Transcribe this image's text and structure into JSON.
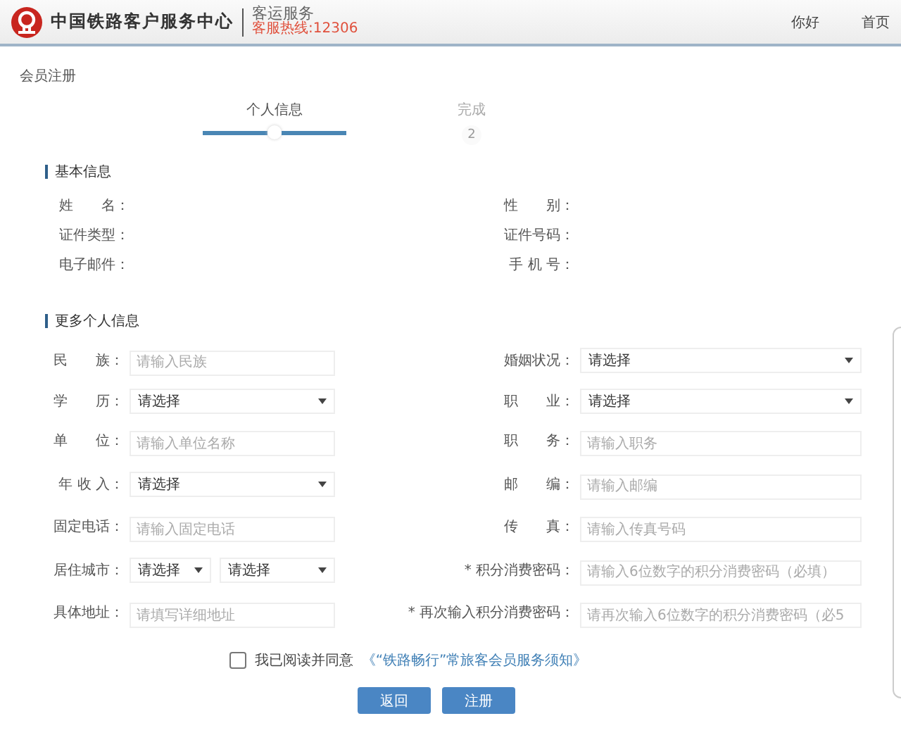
{
  "header": {
    "brand": "中国铁路客户服务中心",
    "service": "客运服务",
    "hotline": "客服热线:12306",
    "greeting": "你好",
    "home_link": "首页"
  },
  "breadcrumb": "会员注册",
  "steps": [
    {
      "label": "个人信息",
      "selected": true
    },
    {
      "label": "完成",
      "number": "2",
      "selected": false
    }
  ],
  "basic_info": {
    "title": "基本信息",
    "fields": [
      {
        "label": "姓　　名："
      },
      {
        "label": "性　　别："
      },
      {
        "label": "证件类型："
      },
      {
        "label": "证件号码："
      },
      {
        "label": "电子邮件："
      },
      {
        "label": "手 机 号："
      }
    ]
  },
  "more_info": {
    "title": "更多个人信息",
    "fields": [
      {
        "label": "民　　族：",
        "kind": "input",
        "placeholder": "请输入民族"
      },
      {
        "label": "婚姻状况：",
        "kind": "select",
        "value": "请选择"
      },
      {
        "label": "学　　历：",
        "kind": "select",
        "value": "请选择"
      },
      {
        "label": "职　　业：",
        "kind": "select",
        "value": "请选择"
      },
      {
        "label": "单　　位：",
        "kind": "input",
        "placeholder": "请输入单位名称"
      },
      {
        "label": "职　　务：",
        "kind": "input",
        "placeholder": "请输入职务"
      },
      {
        "label": "年 收 入：",
        "kind": "select",
        "value": "请选择"
      },
      {
        "label": "邮　　编：",
        "kind": "input",
        "placeholder": "请输入邮编"
      },
      {
        "label": "固定电话：",
        "kind": "input",
        "placeholder": "请输入固定电话"
      },
      {
        "label": "传　　真：",
        "kind": "input",
        "placeholder": "请输入传真号码"
      },
      {
        "label": "居住城市：",
        "kind": "double_select",
        "values": [
          "请选择",
          "请选择"
        ]
      },
      {
        "label": "* 积分消费密码：",
        "kind": "input",
        "placeholder": "请输入6位数字的积分消费密码（必填）"
      },
      {
        "label": "具体地址：",
        "kind": "input",
        "placeholder": "请填写详细地址"
      },
      {
        "label": "* 再次输入积分消费密码：",
        "kind": "input",
        "placeholder": "请再次输入6位数字的积分消费密码（必5"
      }
    ]
  },
  "agreement": {
    "checked": false,
    "text": "我已阅读并同意",
    "link": "《“铁路畅行”常旅客会员服务须知》"
  },
  "buttons": [
    {
      "label": "返回"
    },
    {
      "label": "注册"
    }
  ]
}
